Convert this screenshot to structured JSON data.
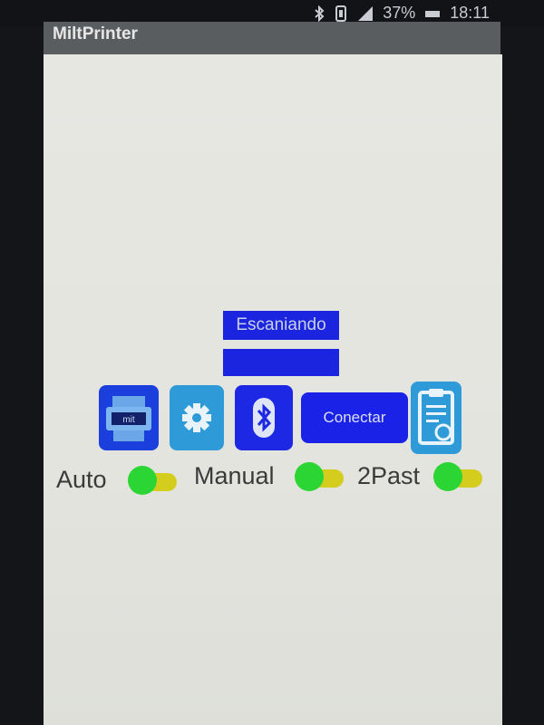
{
  "status_bar": {
    "battery_percent": "37%",
    "time": "18:11",
    "icons": [
      "bluetooth-icon",
      "vibrate-icon",
      "signal-icon",
      "battery-icon"
    ]
  },
  "app": {
    "title": "MiltPrinter"
  },
  "scan": {
    "status_label": "Escaniando"
  },
  "toolbar": {
    "printer_icon": "printer-icon",
    "settings_icon": "gear-icon",
    "bluetooth_icon": "bluetooth-icon",
    "connect_label": "Conectar",
    "clipboard_icon": "clipboard-icon"
  },
  "toggles": [
    {
      "label": "Auto",
      "on": true
    },
    {
      "label": "Manual",
      "on": true
    },
    {
      "label": "2Past",
      "on": true
    }
  ],
  "colors": {
    "primary_blue": "#1a22e8",
    "light_blue": "#2e9ad8",
    "toggle_thumb": "#2bd534",
    "toggle_track": "#d4cd1d",
    "titlebar": "#5a5d60"
  }
}
